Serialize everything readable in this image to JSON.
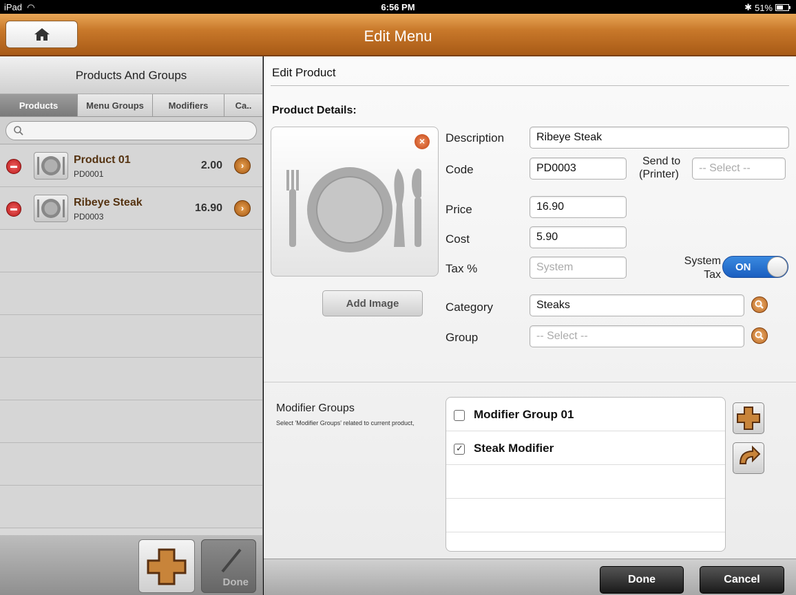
{
  "status": {
    "device": "iPad",
    "time": "6:56 PM",
    "battery": "51%",
    "battery_level": 0.51
  },
  "nav": {
    "title": "Edit Menu"
  },
  "left": {
    "header": "Products And Groups",
    "tabs": [
      "Products",
      "Menu Groups",
      "Modifiers",
      "Ca.."
    ],
    "active_tab": "Products",
    "products": [
      {
        "name": "Product 01",
        "code": "PD0001",
        "price": "2.00"
      },
      {
        "name": "Ribeye Steak",
        "code": "PD0003",
        "price": "16.90"
      }
    ],
    "done_label": "Done"
  },
  "right": {
    "edit_title": "Edit Product",
    "details_title": "Product Details:",
    "add_image_label": "Add Image",
    "labels": {
      "description": "Description",
      "code": "Code",
      "send_to": "Send to",
      "send_to_sub": "(Printer)",
      "price": "Price",
      "cost": "Cost",
      "tax": "Tax  %",
      "system_tax_1": "System",
      "system_tax_2": "Tax",
      "category": "Category",
      "group": "Group"
    },
    "values": {
      "description": "Ribeye Steak",
      "code": "PD0003",
      "price": "16.90",
      "cost": "5.90",
      "category": "Steaks"
    },
    "placeholders": {
      "printer": "-- Select --",
      "tax": "System",
      "group": "-- Select --"
    },
    "system_tax_toggle": "ON",
    "modifier_groups": {
      "title": "Modifier Groups",
      "description": "Select 'Modifier Groups' related to current product,",
      "items": [
        {
          "label": "Modifier Group 01",
          "checked": false
        },
        {
          "label": "Steak Modifier",
          "checked": true
        }
      ]
    },
    "done_label": "Done",
    "cancel_label": "Cancel"
  },
  "colors": {
    "accent": "#c8782a",
    "toggle_on": "#1a5ec0",
    "delete": "#c82020"
  }
}
